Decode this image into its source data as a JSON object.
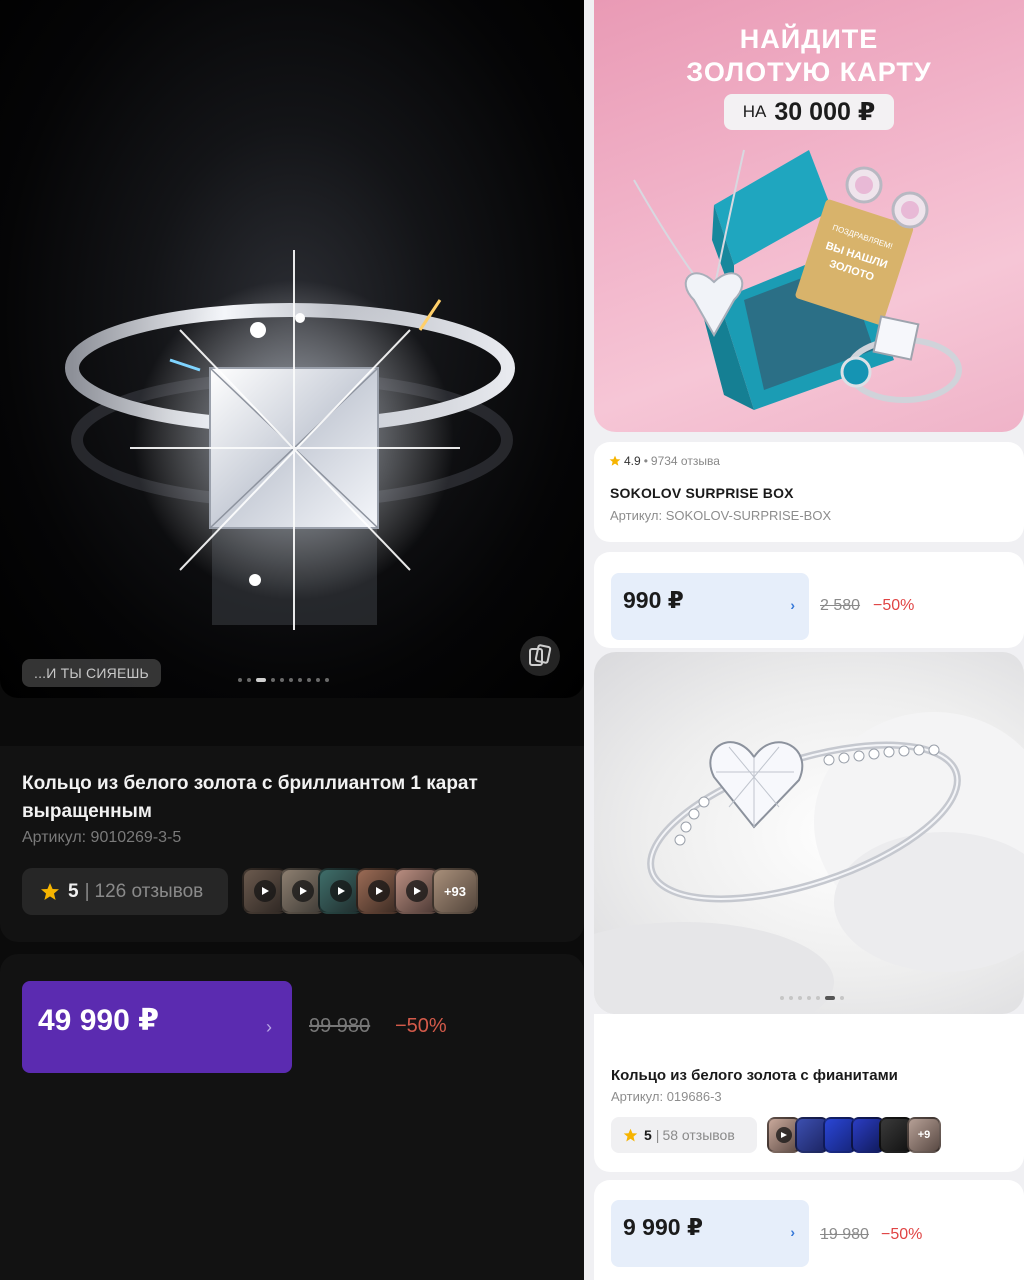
{
  "left_product": {
    "photo_caption": "...И ТЫ СИЯЕШЬ",
    "title": "Кольцо из белого золота с бриллиантом 1 карат выращенным",
    "sku": "Артикул: 9010269-3-5",
    "rating": "5",
    "reviews": "126 отзывов",
    "thumbs_more": "+93",
    "price": "49 990 ₽",
    "old_price": "99 980",
    "discount": "−50%"
  },
  "banner": {
    "line1": "НАЙДИТЕ",
    "line2": "ЗОЛОТУЮ КАРТУ",
    "pill_small": "НА",
    "pill_big": "30 000 ₽",
    "card_line1": "ПОЗДРАВЛЯЕМ!",
    "card_line2": "ВЫ НАШЛИ",
    "card_line3": "ЗОЛОТО"
  },
  "box_product": {
    "rating": "4.9",
    "reviews": "9734 отзыва",
    "title": "SOKOLOV SURPRISE BOX",
    "sku": "Артикул: SOKOLOV-SURPRISE-BOX",
    "price": "990 ₽",
    "old_price": "2 580",
    "discount": "−50%"
  },
  "heart_ring_product": {
    "title": "Кольцо из белого золота с фианитами",
    "sku": "Артикул: 019686-3",
    "rating": "5",
    "reviews": "58 отзывов",
    "thumbs_more": "+9",
    "price": "9 990 ₽",
    "old_price": "19 980",
    "discount": "−50%"
  },
  "colors": {
    "dark_bg": "#0b0b0b",
    "purple_price": "#5b2bb0",
    "light_price": "#e6eefa",
    "discount_red": "#e04444",
    "star": "#f6b400",
    "banner_pink": "#f2b6cb"
  },
  "icons": [
    "star-icon",
    "chevron-right-icon",
    "copy-icon",
    "play-icon"
  ]
}
